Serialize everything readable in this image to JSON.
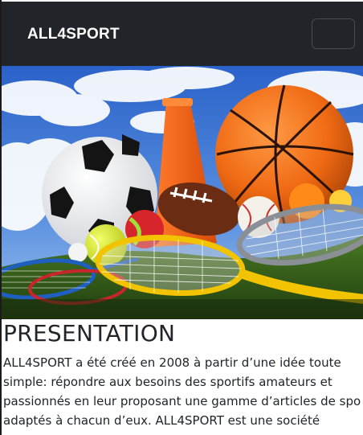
{
  "navbar": {
    "brand": "ALL4SPORT",
    "toggle_icon": "menu-toggle-icon"
  },
  "hero": {
    "image_subject": "sports equipment",
    "icon": "sports-equipment-image"
  },
  "main": {
    "title": "PRESENTATION",
    "paragraph_lines": [
      "ALL4SPORT a été créé en 2008 à partir d’une idée toute",
      "simple: répondre aux besoins des sportifs amateurs et",
      "passionnés en leur proposant une gamme d’articles de spo",
      "adaptés à chacun d’eux. ALL4SPORT est une société"
    ]
  },
  "colors": {
    "navbar_bg": "#212529",
    "brand_text": "#ffffff",
    "body_text": "#212529"
  }
}
